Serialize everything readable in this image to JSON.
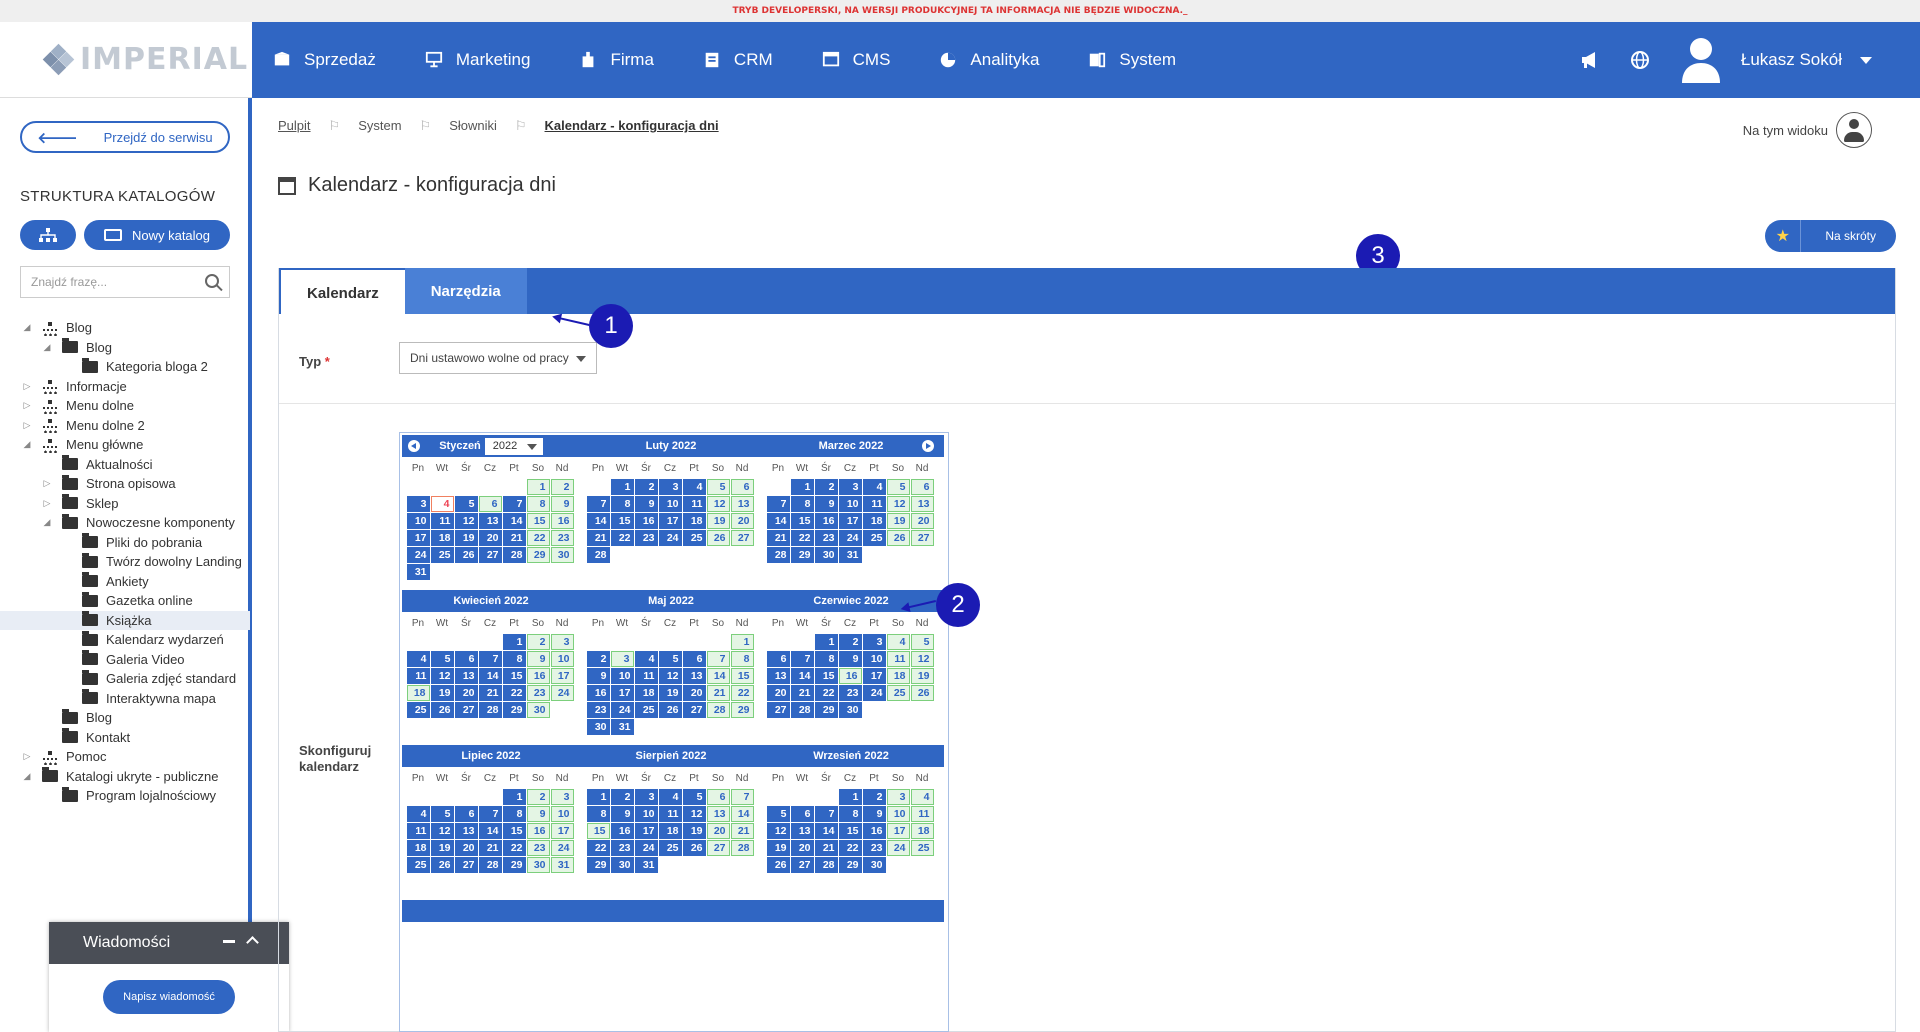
{
  "dev_banner": "TRYB DEVELOPERSKI, NA WERSJI PRODUKCYJNEJ TA INFORMACJA NIE BĘDZIE WIDOCZNA._",
  "logo_text": "IMPERIAL",
  "nav": {
    "items": [
      "Sprzedaż",
      "Marketing",
      "Firma",
      "CRM",
      "CMS",
      "Analityka",
      "System"
    ],
    "icons": [
      "box-icon",
      "presentation-icon",
      "building-icon",
      "crm-icon",
      "cms-icon",
      "analytics-icon",
      "system-icon"
    ],
    "user_name": "Łukasz Sokół"
  },
  "sidebar": {
    "goto_label": "Przejdź do serwisu",
    "structure_title": "STRUKTURA KATALOGÓW",
    "new_catalog_label": "Nowy katalog",
    "search_placeholder": "Znajdź frazę...",
    "tree": [
      {
        "label": "Blog",
        "level": 0,
        "toggle": "◢",
        "icon": "struct"
      },
      {
        "label": "Blog",
        "level": 1,
        "toggle": "◢",
        "icon": "folder"
      },
      {
        "label": "Kategoria bloga 2",
        "level": 2,
        "toggle": "",
        "icon": "folder"
      },
      {
        "label": "Informacje",
        "level": 0,
        "toggle": "▷",
        "icon": "struct"
      },
      {
        "label": "Menu dolne",
        "level": 0,
        "toggle": "▷",
        "icon": "struct"
      },
      {
        "label": "Menu dolne 2",
        "level": 0,
        "toggle": "▷",
        "icon": "struct"
      },
      {
        "label": "Menu główne",
        "level": 0,
        "toggle": "◢",
        "icon": "struct"
      },
      {
        "label": "Aktualności",
        "level": 1,
        "toggle": "",
        "icon": "folder"
      },
      {
        "label": "Strona opisowa",
        "level": 1,
        "toggle": "▷",
        "icon": "folder"
      },
      {
        "label": "Sklep",
        "level": 1,
        "toggle": "▷",
        "icon": "folder"
      },
      {
        "label": "Nowoczesne komponenty",
        "level": 1,
        "toggle": "◢",
        "icon": "folder"
      },
      {
        "label": "Pliki do pobrania",
        "level": 2,
        "toggle": "",
        "icon": "folder"
      },
      {
        "label": "Twórz dowolny Landing",
        "level": 2,
        "toggle": "",
        "icon": "folder"
      },
      {
        "label": "Ankiety",
        "level": 2,
        "toggle": "",
        "icon": "folder"
      },
      {
        "label": "Gazetka online",
        "level": 2,
        "toggle": "",
        "icon": "folder"
      },
      {
        "label": "Książka",
        "level": 2,
        "toggle": "",
        "icon": "folder",
        "selected": true
      },
      {
        "label": "Kalendarz wydarzeń",
        "level": 2,
        "toggle": "",
        "icon": "folder"
      },
      {
        "label": "Galeria Video",
        "level": 2,
        "toggle": "",
        "icon": "folder"
      },
      {
        "label": "Galeria zdjęć standard",
        "level": 2,
        "toggle": "",
        "icon": "folder"
      },
      {
        "label": "Interaktywna mapa",
        "level": 2,
        "toggle": "",
        "icon": "folder"
      },
      {
        "label": "Blog",
        "level": 1,
        "toggle": "",
        "icon": "folder"
      },
      {
        "label": "Kontakt",
        "level": 1,
        "toggle": "",
        "icon": "folder"
      },
      {
        "label": "Pomoc",
        "level": 0,
        "toggle": "▷",
        "icon": "struct"
      },
      {
        "label": "Katalogi ukryte - publiczne",
        "level": 0,
        "toggle": "◢",
        "icon": "folder"
      },
      {
        "label": "Program lojalnościowy",
        "level": 1,
        "toggle": "",
        "icon": "folder"
      }
    ]
  },
  "messages": {
    "title": "Wiadomości",
    "write_label": "Napisz wiadomość"
  },
  "breadcrumb": [
    "Pulpit",
    "System",
    "Słowniki",
    "Kalendarz - konfiguracja dni"
  ],
  "view_label": "Na tym widoku",
  "page_title": "Kalendarz - konfiguracja dni",
  "shortcuts_label": "Na skróty",
  "tabs": [
    "Kalendarz",
    "Narzędzia"
  ],
  "form": {
    "type_label": "Typ",
    "required_mark": "*",
    "type_value": "Dni ustawowo wolne od pracy",
    "configure_label": "Skonfiguruj kalendarz"
  },
  "annotations": [
    "1",
    "2",
    "3"
  ],
  "calendar": {
    "year": "2022",
    "weekdays": [
      "Pn",
      "Wt",
      "Śr",
      "Cz",
      "Pt",
      "So",
      "Nd"
    ],
    "months": [
      {
        "name": "Styczeń",
        "start": 5,
        "days": 31,
        "today": 4,
        "off": [
          1,
          6
        ]
      },
      {
        "name": "Luty 2022",
        "start": 1,
        "days": 28,
        "off": []
      },
      {
        "name": "Marzec 2022",
        "start": 1,
        "days": 31,
        "off": []
      },
      {
        "name": "Kwiecień 2022",
        "start": 4,
        "days": 30,
        "off": [
          18
        ]
      },
      {
        "name": "Maj 2022",
        "start": 6,
        "days": 31,
        "off": [
          3
        ]
      },
      {
        "name": "Czerwiec 2022",
        "start": 2,
        "days": 30,
        "off": [
          16
        ]
      },
      {
        "name": "Lipiec 2022",
        "start": 4,
        "days": 31,
        "off": []
      },
      {
        "name": "Sierpień 2022",
        "start": 0,
        "days": 31,
        "off": [
          15
        ]
      },
      {
        "name": "Wrzesień 2022",
        "start": 3,
        "days": 30,
        "off": []
      }
    ]
  }
}
